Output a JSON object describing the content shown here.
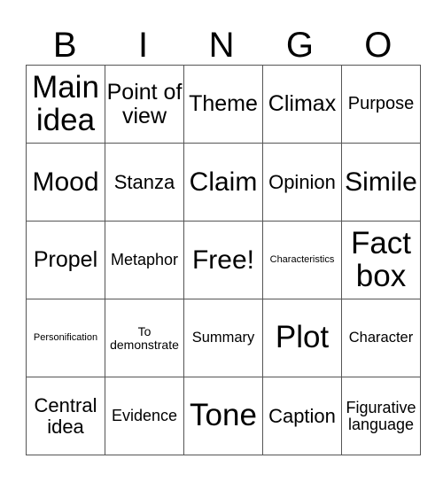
{
  "header": [
    "B",
    "I",
    "N",
    "G",
    "O"
  ],
  "rows": [
    [
      "Main idea",
      "Point of view",
      "Theme",
      "Climax",
      "Purpose"
    ],
    [
      "Mood",
      "Stanza",
      "Claim",
      "Opinion",
      "Simile"
    ],
    [
      "Propel",
      "Metaphor",
      "Free!",
      "Characteristics",
      "Fact box"
    ],
    [
      "Personification",
      "To demonstrate",
      "Summary",
      "Plot",
      "Character"
    ],
    [
      "Central idea",
      "Evidence",
      "Tone",
      "Caption",
      "Figurative language"
    ]
  ]
}
